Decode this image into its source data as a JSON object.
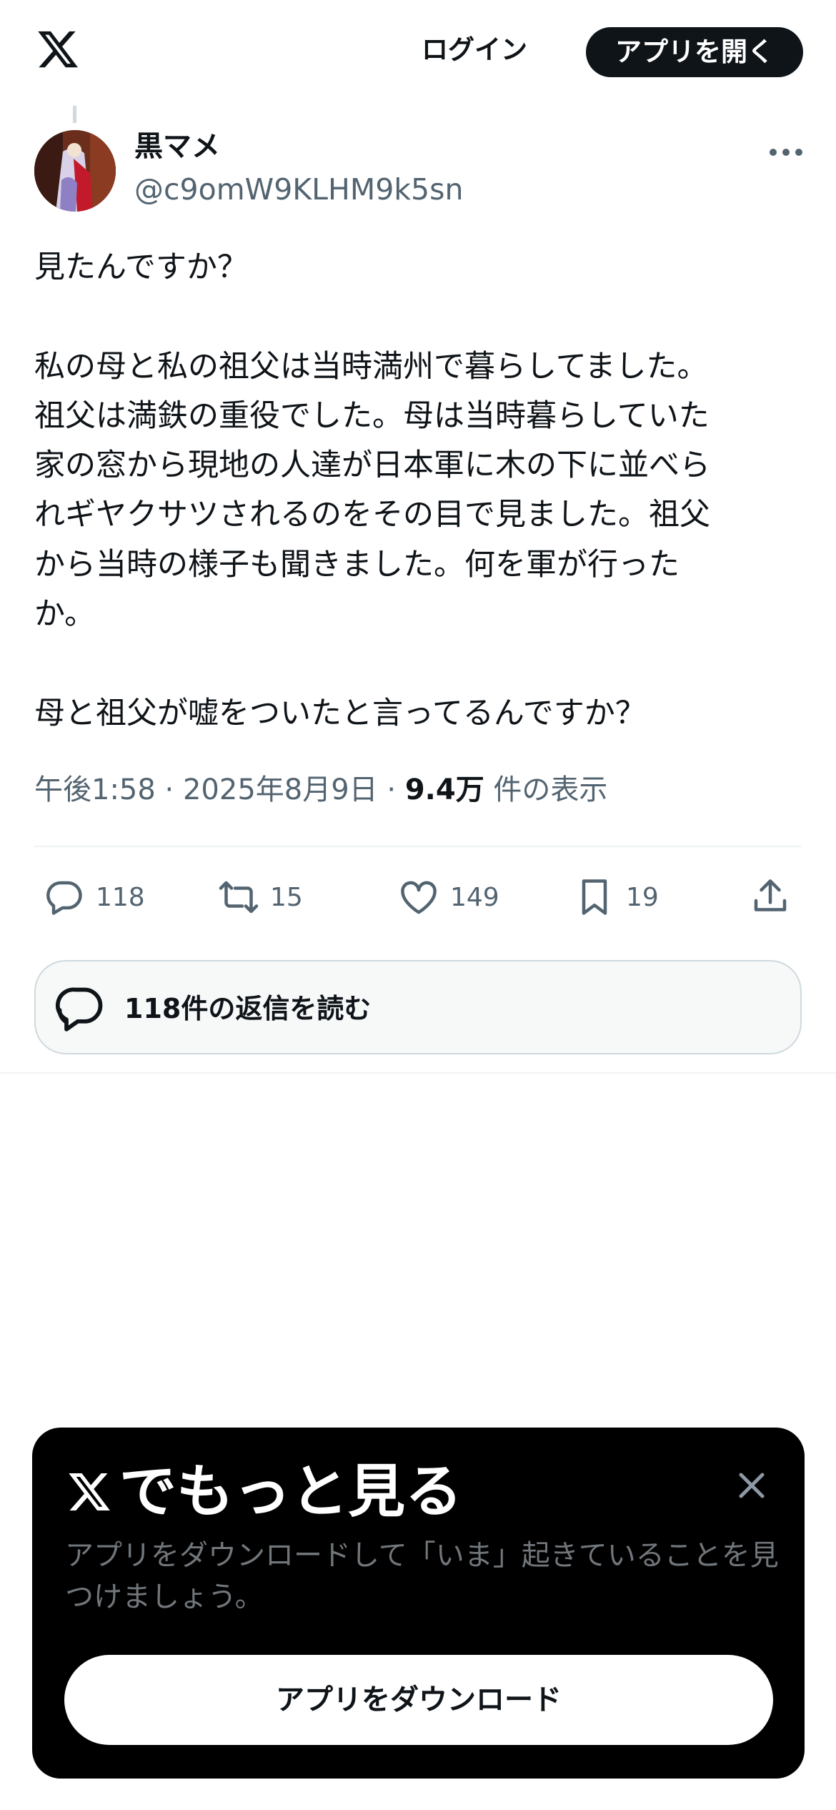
{
  "header": {
    "logo_icon": "x-logo-icon",
    "login_label": "ログイン",
    "open_app_label": "アプリを開く"
  },
  "tweet": {
    "author": {
      "name": "黒マメ",
      "handle": "@c9omW9KLHM9k5sn",
      "avatar_icon": "avatar-image"
    },
    "text": "見たんですか？\n\n私の母と私の祖父は当時満州で暮らしてました。\n祖父は満鉄の重役でした。母は当時暮らしていた\n家の窓から現地の人達が日本軍に木の下に並べら\nれギヤクサツされるのをその目で見ました。祖父\nから当時の様子も聞きました。何を軍が行った\nか。\n\n母と祖父が嘘をついたと言ってるんですか？",
    "time": "午後1:58",
    "date": "2025年8月9日",
    "separator": "·",
    "views_count": "9.4万",
    "views_label": "件の表示",
    "actions": {
      "reply_count": "118",
      "retweet_count": "15",
      "like_count": "149",
      "bookmark_count": "19"
    },
    "read_replies_label": "118件の返信を読む"
  },
  "promo": {
    "title": "でもっと見る",
    "description": "アプリをダウンロードして「いま」起きていることを見つけましょう。",
    "button_label": "アプリをダウンロード"
  },
  "colors": {
    "text_primary": "#0f1419",
    "text_secondary": "#536471",
    "border": "#cfd9de",
    "promo_bg": "#000000",
    "promo_desc": "#71767b"
  }
}
